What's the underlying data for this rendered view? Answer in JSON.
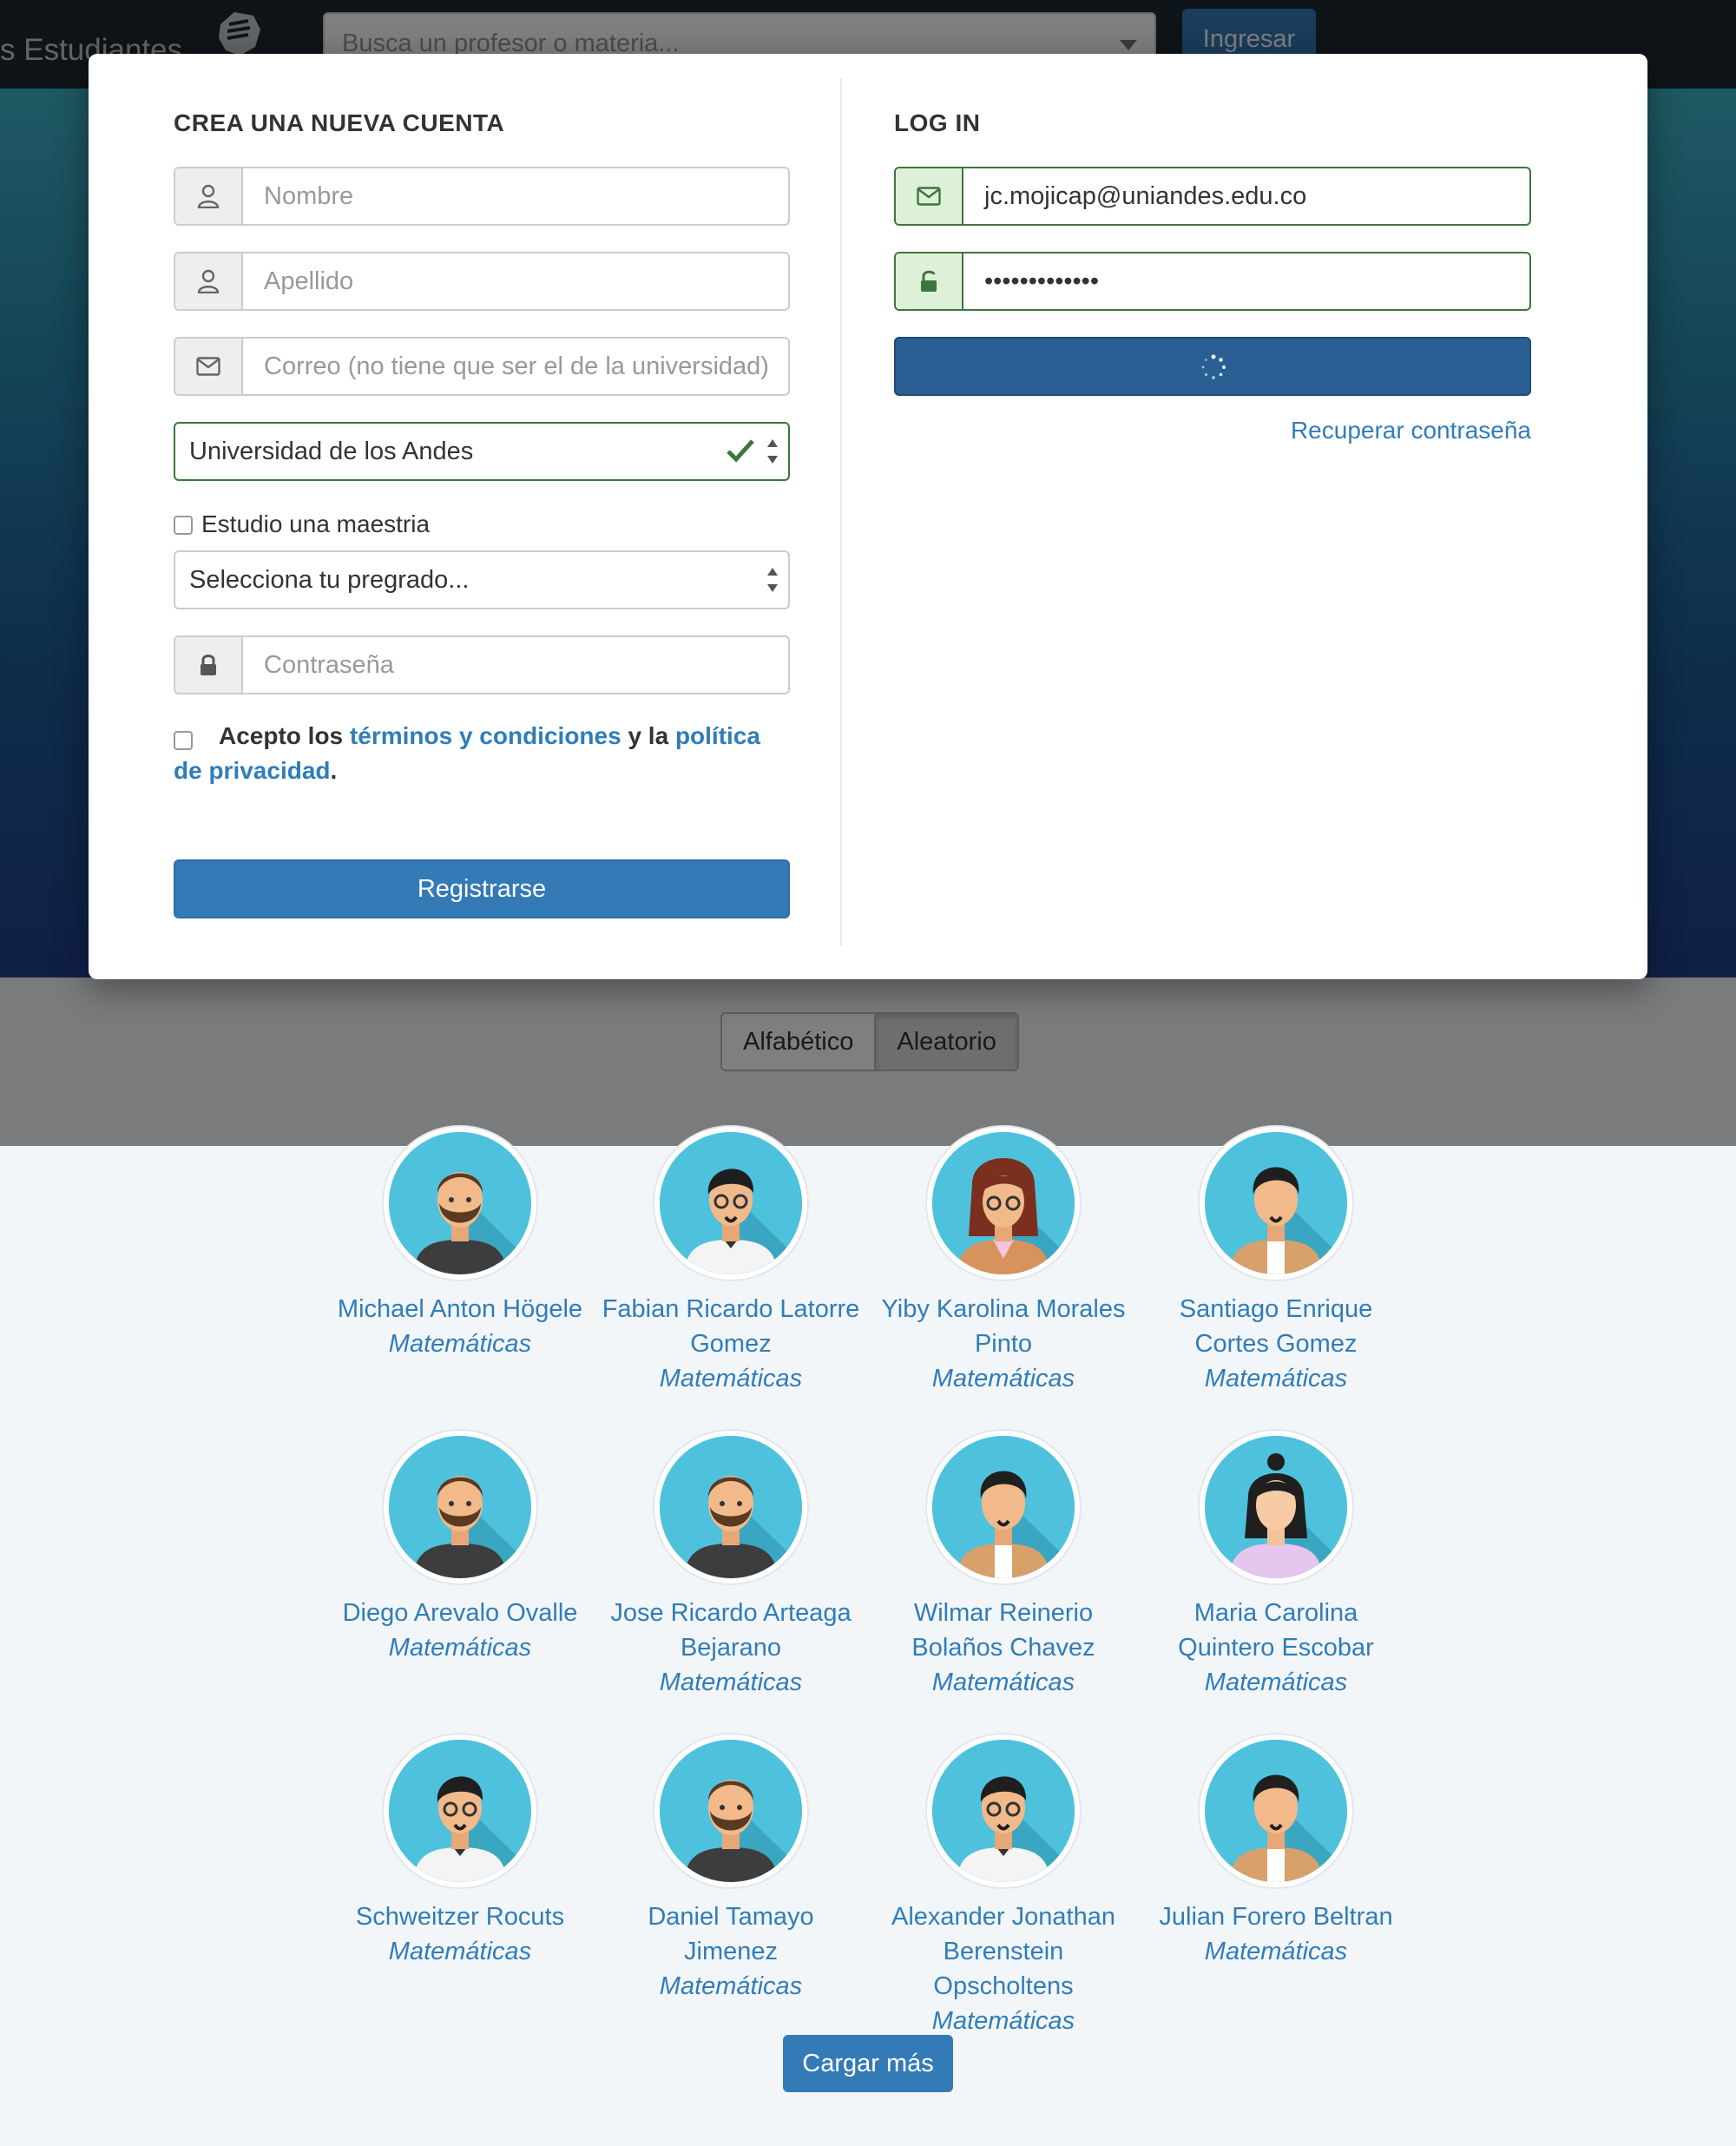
{
  "navbar": {
    "brand": "s Estudiantes",
    "search_placeholder": "Busca un profesor o materia...",
    "login_label": "Ingresar"
  },
  "sort": {
    "alphabetic": "Alfabético",
    "random": "Aleatorio"
  },
  "signup": {
    "title": "CREA UNA NUEVA CUENTA",
    "first_name_placeholder": "Nombre",
    "last_name_placeholder": "Apellido",
    "email_placeholder": "Correo (no tiene que ser el de la universidad)",
    "university_value": "Universidad de los Andes",
    "masters_label": "Estudio una maestria",
    "program_placeholder": "Selecciona tu pregrado...",
    "password_placeholder": "Contraseña",
    "terms_prefix": "Acepto los",
    "terms_link": "términos y condiciones",
    "terms_middle": "y la",
    "privacy_link_1": "política",
    "privacy_link_2": "de privacidad",
    "terms_suffix": ".",
    "submit_label": "Registrarse"
  },
  "login": {
    "title": "LOG IN",
    "email_value": "jc.mojicap@uniandes.edu.co",
    "password_value": "•••••••••••••",
    "recover_label": "Recuperar contraseña"
  },
  "professors": [
    {
      "name": "Michael Anton Högele",
      "subject": "Matemáticas",
      "avatar": "man-beard-dark-shirt"
    },
    {
      "name": "Fabian Ricardo Latorre Gomez",
      "subject": "Matemáticas",
      "avatar": "man-glasses-white-shirt"
    },
    {
      "name": "Yiby Karolina Morales Pinto",
      "subject": "Matemáticas",
      "avatar": "woman-glasses-brown-hair"
    },
    {
      "name": "Santiago Enrique Cortes Gomez",
      "subject": "Matemáticas",
      "avatar": "man-tan-jacket"
    },
    {
      "name": "Diego Arevalo Ovalle",
      "subject": "Matemáticas",
      "avatar": "man-beard-dark-shirt"
    },
    {
      "name": "Jose Ricardo Arteaga Bejarano",
      "subject": "Matemáticas",
      "avatar": "man-beard-dark-shirt"
    },
    {
      "name": "Wilmar Reinerio Bolaños Chavez",
      "subject": "Matemáticas",
      "avatar": "man-tan-jacket"
    },
    {
      "name": "Maria Carolina Quintero Escobar",
      "subject": "Matemáticas",
      "avatar": "woman-black-hair"
    },
    {
      "name": "Schweitzer Rocuts",
      "subject": "Matemáticas",
      "avatar": "man-glasses-white-shirt"
    },
    {
      "name": "Daniel Tamayo Jimenez",
      "subject": "Matemáticas",
      "avatar": "man-beard-dark-shirt"
    },
    {
      "name": "Alexander Jonathan Berenstein Opscholtens",
      "subject": "Matemáticas",
      "avatar": "man-glasses-white-shirt"
    },
    {
      "name": "Julian Forero Beltran",
      "subject": "Matemáticas",
      "avatar": "man-tan-jacket"
    }
  ],
  "load_more_label": "Cargar más",
  "colors": {
    "link": "#2f7dba",
    "primary": "#337ab7",
    "success": "#3c763d",
    "avatar_bg": "#4ec1dd"
  }
}
